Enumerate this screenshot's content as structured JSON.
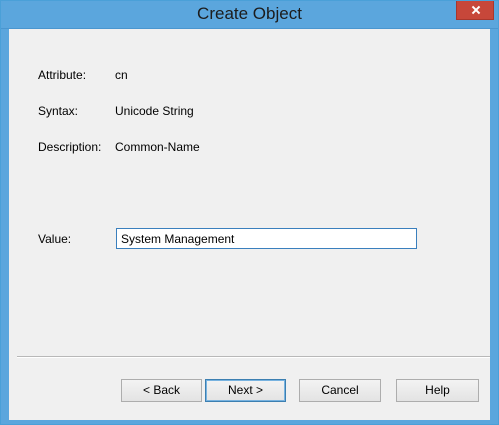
{
  "window": {
    "title": "Create Object"
  },
  "fields": {
    "attribute_label": "Attribute:",
    "attribute_value": "cn",
    "syntax_label": "Syntax:",
    "syntax_value": "Unicode String",
    "description_label": "Description:",
    "description_value": "Common-Name",
    "value_label": "Value:",
    "value_input": "System Management"
  },
  "buttons": {
    "back": "< Back",
    "next": "Next >",
    "cancel": "Cancel",
    "help": "Help"
  },
  "colors": {
    "title_bar": "#5ba6dd",
    "close_button": "#c7473a",
    "dialog_background": "#f0f0f0",
    "input_border": "#3a7fbd"
  },
  "icons": {
    "close": "close-icon"
  }
}
